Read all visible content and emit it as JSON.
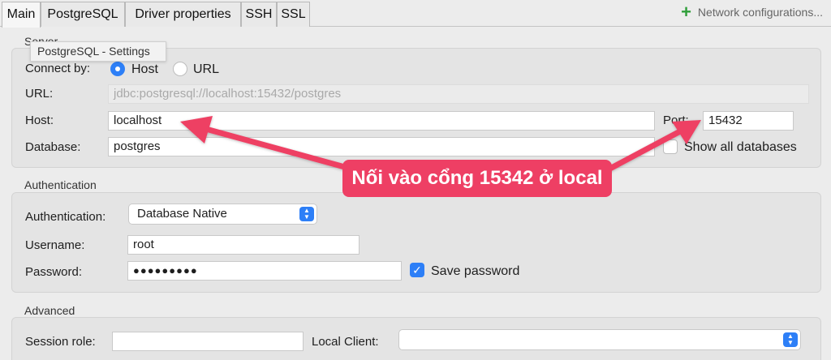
{
  "tabs": [
    {
      "label": "Main",
      "active": true
    },
    {
      "label": "PostgreSQL",
      "active": false
    },
    {
      "label": "Driver properties",
      "active": false
    },
    {
      "label": "SSH",
      "active": false
    },
    {
      "label": "SSL",
      "active": false
    }
  ],
  "network_config": {
    "label": "Network configurations...",
    "icon": "plus-icon"
  },
  "tooltip": "PostgreSQL - Settings",
  "server": {
    "title": "Server",
    "connect_by_label": "Connect by:",
    "option_host": "Host",
    "option_url": "URL",
    "selected": "Host",
    "url_label": "URL:",
    "url_value": "jdbc:postgresql://localhost:15432/postgres",
    "host_label": "Host:",
    "host_value": "localhost",
    "port_label": "Port:",
    "port_value": "15432",
    "database_label": "Database:",
    "database_value": "postgres",
    "show_all_label": "Show all databases",
    "show_all_checked": false
  },
  "auth": {
    "title": "Authentication",
    "auth_label": "Authentication:",
    "auth_value": "Database Native",
    "username_label": "Username:",
    "username_value": "root",
    "password_label": "Password:",
    "password_value": "●●●●●●●●●",
    "save_password_label": "Save password",
    "save_password_checked": true
  },
  "advanced": {
    "title": "Advanced",
    "session_role_label": "Session role:",
    "session_role_value": "",
    "local_client_label": "Local Client:",
    "local_client_value": ""
  },
  "annotation": {
    "text": "Nối vào cổng 15342 ở local",
    "color": "#ee3f64"
  },
  "colors": {
    "accent": "#2d7ff7",
    "plus": "#2f9e3a"
  }
}
